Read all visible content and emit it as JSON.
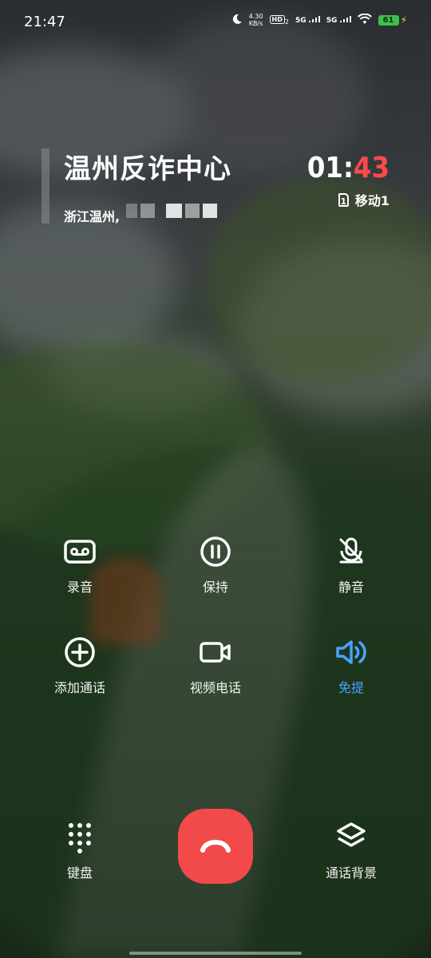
{
  "status_bar": {
    "time": "21:47",
    "net_speed_value": "4.30",
    "net_speed_unit": "KB/s",
    "hd_label": "HD",
    "hd_sub": "2",
    "signal1": "5G",
    "signal2": "5G",
    "battery_level": "61",
    "icons": [
      "moon-icon",
      "hd-icon",
      "signal-icon",
      "signal-icon",
      "wifi-icon",
      "battery-icon",
      "charging-icon"
    ]
  },
  "caller": {
    "name": "温州反诈中心",
    "location": "浙江温州,"
  },
  "call": {
    "duration_min": "01",
    "duration_colon": ":",
    "duration_sec": "43",
    "sim_number": "1",
    "carrier": "移动1"
  },
  "controls": [
    {
      "id": "record",
      "label": "录音",
      "icon": "voicemail-icon",
      "active": false
    },
    {
      "id": "hold",
      "label": "保持",
      "icon": "pause-icon",
      "active": false
    },
    {
      "id": "mute",
      "label": "静音",
      "icon": "mic-off-icon",
      "active": false
    },
    {
      "id": "add-call",
      "label": "添加通话",
      "icon": "add-circle-icon",
      "active": false
    },
    {
      "id": "video-call",
      "label": "视频电话",
      "icon": "video-icon",
      "active": false
    },
    {
      "id": "speaker",
      "label": "免提",
      "icon": "speaker-icon",
      "active": true
    }
  ],
  "bottom": {
    "keypad_label": "键盘",
    "background_label": "通话背景"
  },
  "colors": {
    "end_call": "#f24a4a",
    "timer_seconds": "#ff4a4a",
    "active_control": "#4aa3ff",
    "battery": "#3cc04a"
  }
}
